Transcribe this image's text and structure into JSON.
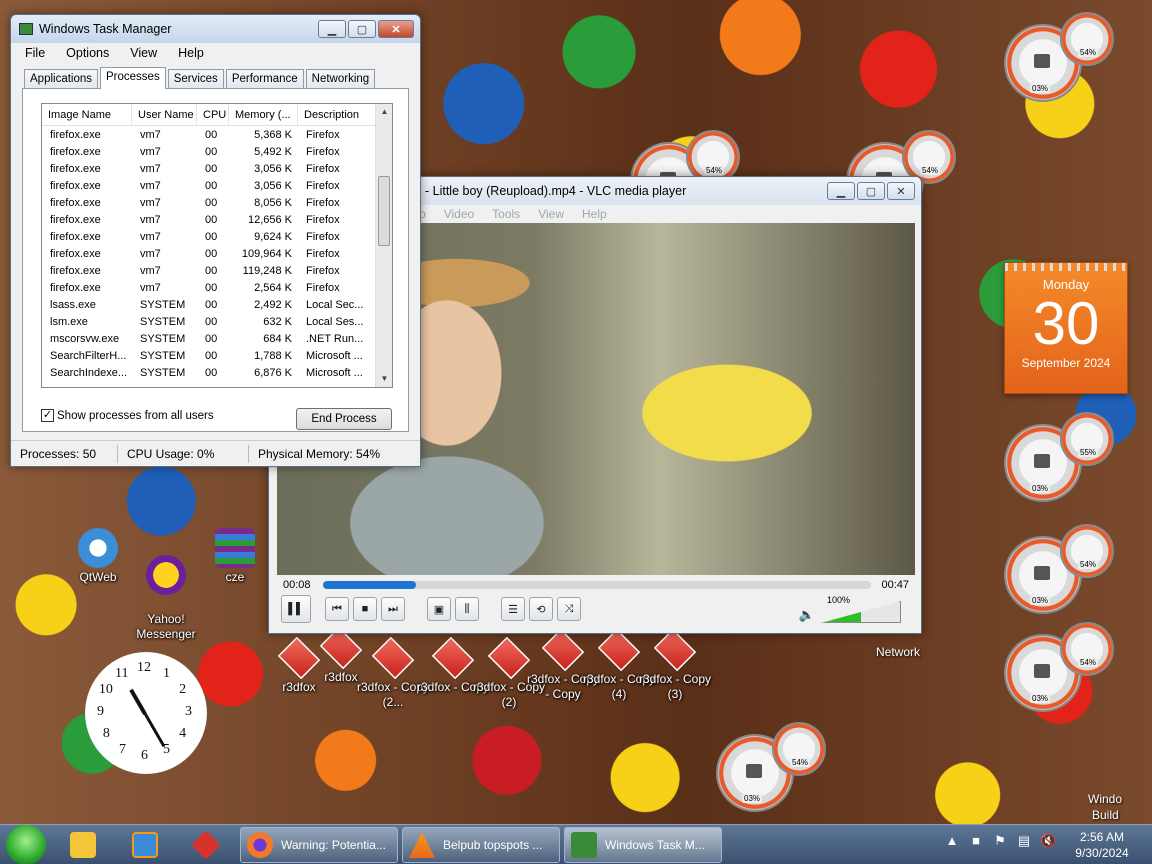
{
  "taskmgr": {
    "title": "Windows Task Manager",
    "menu": [
      "File",
      "Options",
      "View",
      "Help"
    ],
    "tabs": [
      "Applications",
      "Processes",
      "Services",
      "Performance",
      "Networking"
    ],
    "columns": [
      "Image Name",
      "User Name",
      "CPU",
      "Memory (...",
      "Description"
    ],
    "rows": [
      [
        "firefox.exe",
        "vm7",
        "00",
        "5,368 K",
        "Firefox"
      ],
      [
        "firefox.exe",
        "vm7",
        "00",
        "5,492 K",
        "Firefox"
      ],
      [
        "firefox.exe",
        "vm7",
        "00",
        "3,056 K",
        "Firefox"
      ],
      [
        "firefox.exe",
        "vm7",
        "00",
        "3,056 K",
        "Firefox"
      ],
      [
        "firefox.exe",
        "vm7",
        "00",
        "8,056 K",
        "Firefox"
      ],
      [
        "firefox.exe",
        "vm7",
        "00",
        "12,656 K",
        "Firefox"
      ],
      [
        "firefox.exe",
        "vm7",
        "00",
        "9,624 K",
        "Firefox"
      ],
      [
        "firefox.exe",
        "vm7",
        "00",
        "109,964 K",
        "Firefox"
      ],
      [
        "firefox.exe",
        "vm7",
        "00",
        "119,248 K",
        "Firefox"
      ],
      [
        "firefox.exe",
        "vm7",
        "00",
        "2,564 K",
        "Firefox"
      ],
      [
        "lsass.exe",
        "SYSTEM",
        "00",
        "2,492 K",
        "Local Sec..."
      ],
      [
        "lsm.exe",
        "SYSTEM",
        "00",
        "632 K",
        "Local Ses..."
      ],
      [
        "mscorsvw.exe",
        "SYSTEM",
        "00",
        "684 K",
        ".NET Run..."
      ],
      [
        "SearchFilterH...",
        "SYSTEM",
        "00",
        "1,788 K",
        "Microsoft ..."
      ],
      [
        "SearchIndexe...",
        "SYSTEM",
        "00",
        "6,876 K",
        "Microsoft ..."
      ]
    ],
    "show_all_label": "Show processes from all users",
    "show_all_checked": true,
    "end_process_label": "End Process",
    "status": {
      "processes": "Processes: 50",
      "cpu": "CPU Usage: 0%",
      "memory": "Physical Memory: 54%"
    }
  },
  "vlc": {
    "title": "- Little boy (Reupload).mp4 - VLC media player",
    "menu": [
      "o",
      "Video",
      "Tools",
      "View",
      "Help"
    ],
    "time_elapsed": "00:08",
    "time_total": "00:47",
    "progress": 0.17,
    "volume_label": "100%",
    "volume": 1.0,
    "seek_color": "#1d74d2"
  },
  "desktop_icons": [
    {
      "label": "QtWeb",
      "icon": "qtweb-icon"
    },
    {
      "label": "Yahoo!\nMessenger",
      "icon": "yahoo-messenger-icon"
    },
    {
      "label": "cze",
      "icon": "winrar-archive-icon"
    }
  ],
  "r3dfox_icons": [
    "r3dfox",
    "r3dfox",
    "r3dfox - Copy (2...",
    "r3dfox - Copy",
    "r3dfox - Copy (2)",
    "r3dfox - Copy - Copy",
    "r3dfox - Copy (4)",
    "r3dfox - Copy (3)"
  ],
  "gadgets": {
    "meters": [
      {
        "cpu": "03%",
        "mem": "54%"
      },
      {
        "cpu": "03%",
        "mem": "54%"
      },
      {
        "cpu": "03%",
        "mem": "54%"
      },
      {
        "cpu": "03%",
        "mem": "55%"
      },
      {
        "cpu": "03%",
        "mem": "54%"
      },
      {
        "cpu": "03%",
        "mem": "54%"
      },
      {
        "cpu": "03%",
        "mem": "54%"
      }
    ],
    "calendar": {
      "weekday": "Monday",
      "day": "30",
      "month_year": "September 2024",
      "color": "#e3641a"
    },
    "clock_numbers": [
      "12",
      "1",
      "2",
      "3",
      "4",
      "5",
      "6",
      "7",
      "8",
      "9",
      "10",
      "11"
    ]
  },
  "desktop_labels": {
    "network": "Network",
    "windows": "Windo",
    "build": "Build"
  },
  "taskbar": {
    "buttons": [
      {
        "label": "Warning: Potentia...",
        "icon": "firefox-icon"
      },
      {
        "label": "Belpub topspots ...",
        "icon": "vlc-icon"
      },
      {
        "label": "Windows Task M...",
        "icon": "task-manager-icon"
      }
    ],
    "time": "2:56 AM",
    "date": "9/30/2024"
  }
}
